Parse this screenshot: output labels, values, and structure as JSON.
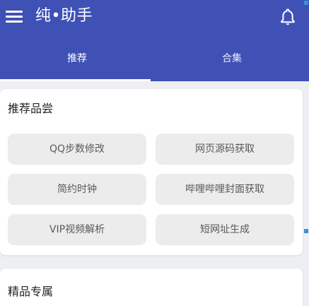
{
  "app": {
    "title": "纯•助手",
    "accent_color": "#3f51b5"
  },
  "toolbar": {
    "menu_icon": "hamburger-menu-icon",
    "bell_icon": "bell-icon"
  },
  "tabs": [
    {
      "label": "推荐",
      "selected": true
    },
    {
      "label": "合集",
      "selected": false
    }
  ],
  "sections": [
    {
      "title": "推荐品尝",
      "items": [
        {
          "label": "QQ步数修改"
        },
        {
          "label": "网页源码获取"
        },
        {
          "label": "简约时钟"
        },
        {
          "label": "哔哩哔哩封面获取"
        },
        {
          "label": "VIP视频解析"
        },
        {
          "label": "短网址生成"
        }
      ]
    },
    {
      "title": "精品专属"
    }
  ]
}
